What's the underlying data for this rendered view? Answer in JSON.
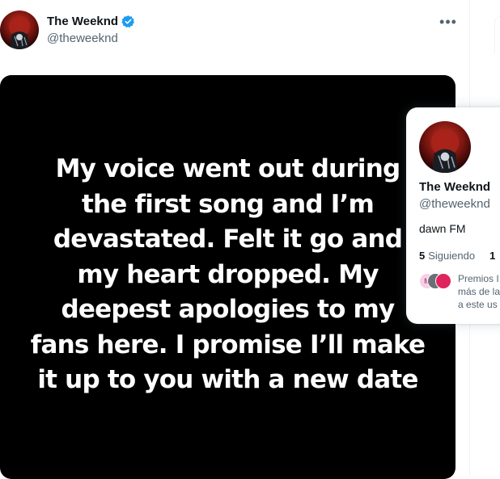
{
  "tweet": {
    "display_name": "The Weeknd",
    "handle": "@theweeknd",
    "more_label": "•••",
    "media_text": "My voice went out during\nthe first song and I’m\ndevastated. Felt it go and\nmy heart dropped. My\ndeepest apologies to my\nfans here. I promise I’ll make\nit up to you with a new date"
  },
  "hover_card": {
    "display_name": "The Weeknd",
    "handle": "@theweeknd",
    "bio": "dawn FM",
    "following_count": "5",
    "following_label": "Siguiendo",
    "followers_count_partial": "1",
    "followed_by_text": "Premios I\nmás de la\na este us",
    "follower_avatar_labels": [
      "M"
    ]
  },
  "colors": {
    "verified_blue": "#1d9bf0",
    "secondary_text": "#536471",
    "avatar_red": "#8b1a12"
  },
  "icons": [
    "verified-badge-icon",
    "more-icon"
  ]
}
